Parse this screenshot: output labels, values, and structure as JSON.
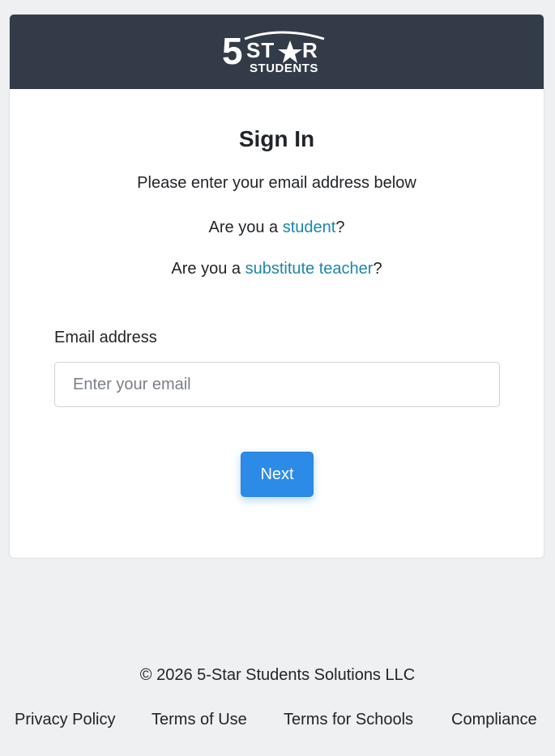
{
  "brand": {
    "logo_line1": "5STAR",
    "logo_line2": "STUDENTS",
    "header_color": "#323b47"
  },
  "signin": {
    "title": "Sign In",
    "subtitle": "Please enter your email address below",
    "student_prefix": "Are you a ",
    "student_link": "student",
    "student_suffix": "?",
    "sub_prefix": "Are you a ",
    "sub_link": "substitute teacher",
    "sub_suffix": "?",
    "link_color": "#1d86a8"
  },
  "form": {
    "email_label": "Email address",
    "email_value": "",
    "email_placeholder": "Enter your email",
    "next_label": "Next",
    "button_color": "#2c8be6"
  },
  "footer": {
    "copyright": "© 2026 5-Star Students Solutions LLC",
    "links": [
      "Privacy Policy",
      "Terms of Use",
      "Terms for Schools",
      "Compliance"
    ]
  }
}
